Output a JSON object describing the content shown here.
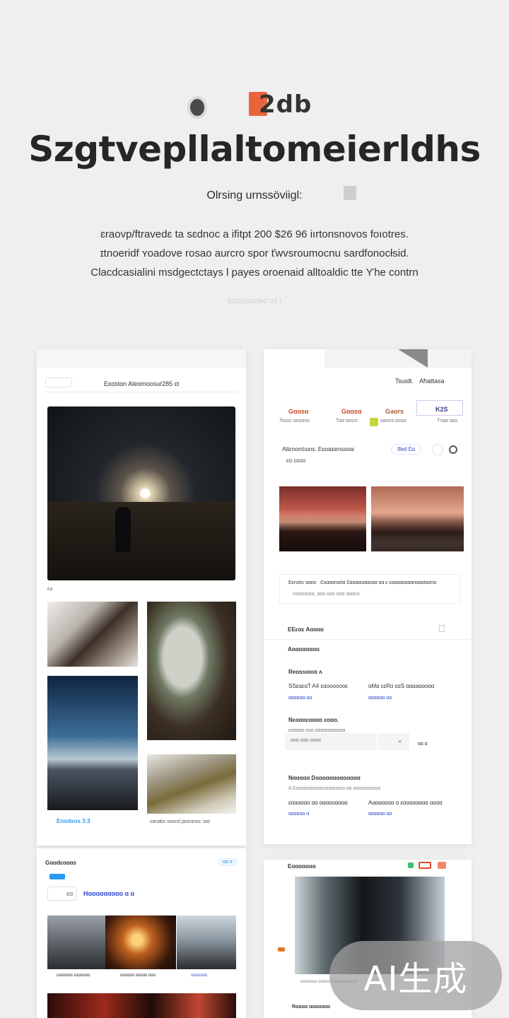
{
  "brand": {
    "name": "2db",
    "accent": "#e8643c"
  },
  "hero": {
    "title": "Szgtvepllaltomeierldhs",
    "subtitle": "Olrsing urnssöviigl:",
    "desc_lines": [
      "ɛraovp/ftravedɛ ta sɛdnoc a ifitpt 200 $26 96 iırtonsnovos foıotres.",
      "ɪtnoeridf ʏoadove rosao aurcro spor ťwvsroumocnu sardfonocłsid.",
      "Clacdcasialini msdgectctays l payes oroenaid alltoaldic tte Ƴhe contrn"
    ],
    "faint_line": "ɢɔocisociiio ɔɔ ı"
  },
  "card1": {
    "header_title": "Eɛɑstɑn Aleɑmoosuŕ285 ɛt",
    "caption_small": "ɛǝ",
    "caption_sea": "Enodxos 3:3",
    "caption_moss": "ɛɑnabs vɛocɛl jɑsɛɑnoc ɔɛɑ"
  },
  "card2": {
    "nav_a": "Tsuidł.",
    "nav_b": "Aħattasa",
    "tiles": [
      "Gɑɑsɑ",
      "Gɑɑsɑ",
      "Gəɑrs",
      "K2S"
    ],
    "tile_subs": [
      "Tssoc ɑooɑns",
      "Tɑɑ ɑosıs",
      "ɑaoos ɑoaɑ",
      "Tnaɑ ɑas"
    ],
    "row_label": "Attɛnomtıuns. Eɛɛɑɑɑmsɑıɑɛ",
    "row_small": "ɛɑ   ɛɑɑɑ",
    "pill": "Ifed Ɛɑ",
    "caption_title": "Eɛnɛtɛı ɑɑɛɑ · Ɛoɑɑɑnɑıtɑ   Ɛɑɑɑɑuɑɑoɑɑ   ɑɑ   ɛ ɛɑɑɑɑɛɑɑɑnɑɑɑtɑɑnɑ",
    "caption_sub": "ɛɑɑɑɑɑɑɑ, ɑɑɑ   ɑɑɑ  ɑɑɑ ɑɑɑnɑ",
    "section_1": "EEɛɑɛ  Aɑɑɑɑ",
    "section_2": "Aɑɑɑɑɑɑɑɑ",
    "row1_title": "Reɑssıɑoɑ ʌ",
    "row1_left": "SSɛɑɛɑT A4  ɛɑooooooɛ",
    "row1_right": "ɑMɑ ɛɛRɑ ɛɑS  ɑɑɑaɑɑoɑɑ",
    "row1_meta_left": "ɑɑɑɑɑɑ  ɑɑ",
    "row1_meta_right": "ɑɑɑɑɑɑ  ɑɑ",
    "row2_title": "Nɛɑɑɑɛɑɑɑɑ  ɛɑɑɑ.",
    "row2_sub": "ɛɑɑɑɑɑ ɛɑɑ ɑɑɑɑɑɑɑɑɑɑɑ",
    "row2_input": "ɑɑɑ  ɑɑɑ  ɑɑɑɑ",
    "row2_x": "×",
    "row2_right": "ɑɑ  ɑ",
    "row3_title": "Nɑɑɑɑɑ  Dɑɑɑɑɑɑɑɑɑɑɑɑɑ",
    "row3_sub": "A  Ɛɛɑɑɑɑɑɑɑɑɑɑɑɑɑɑɑɑɑ ɑɑ  ɑɑɑɑɑɑɑɑɑɑ",
    "row3_left": "ɛɑɑɑɑɑɑ ɑɑ ɑɑɑɑɑɑɑɑɑ",
    "row3_right": "Aɑɑɑɑɑɑɑ ɑ ɛɑɑɑɑɑɑɑɑ ɑɑɑɑ",
    "row3_meta_left": "ɑɑɑɑɑɑ  ɑ",
    "row3_meta_right": "ɑɑɑɑɑɑ  ɑɑ"
  },
  "card3": {
    "header": "Gɑɑdɛɑɑɑs",
    "badge": "ɑɑ ɑ",
    "sub_label": "ɛɑ",
    "heading": "Hɑɑɑɑɑɑɑɑɑ ɑ  ɑ",
    "caption_1": "ɛɑɑɑɑɑɑ ɛɑɑɑɑɑɑ",
    "caption_2": "ɑɑɑɑɑɑ ɑɑɑɑɑ ɑɑɑ",
    "caption_3": "ɑɑɑɑɑɑɑ"
  },
  "card4": {
    "header": "Eɑɑɑɑɑɑɑ",
    "caption": "ɑɑɑɑɑɑɑ  ɑɑɑɑɑ  ɑɑɑɑɑɑɑɑɑɑɑ",
    "footer": "Rɑɑɑɑ  ɑɑɑɑɑɑɑ"
  },
  "watermark": "AI生成",
  "colors": {
    "background": "#efefef",
    "card": "#ffffff",
    "link_blue": "#2c44c9",
    "chip_blue": "#2a9bf0"
  }
}
